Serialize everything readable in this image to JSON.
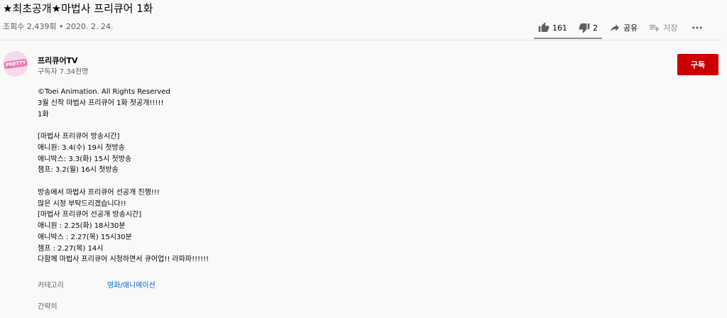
{
  "video": {
    "title": "★최초공개★마법사 프리큐어 1화",
    "views": "조회수 2,439회",
    "separator": "•",
    "date": "2020. 2. 24."
  },
  "actions": {
    "like_count": "161",
    "dislike_count": "2",
    "share_label": "공유",
    "save_label": "저장",
    "like_ratio": 0.988
  },
  "channel": {
    "name": "프리큐어TV",
    "subscribers": "구독자 7.34천명",
    "avatar_text": "PRETTY",
    "subscribe_label": "구독"
  },
  "description": {
    "lines": [
      "©Toei Animation. All Rights Reserved",
      "3월 신작 마법사 프리큐어 1화 첫공개!!!!!",
      "1화",
      "",
      "[마법사 프리큐어 방송시간]",
      "애니원: 3.4(수) 19시 첫방송",
      "애니박스: 3.3(화) 15시 첫방송",
      "챔프: 3.2(월) 16시 첫방송",
      "",
      "방송에서 마법사 프리큐어 선공개 진행!!!",
      "많은 시청 부탁드리겠습니다!!",
      "[마법사 프리큐어 선공개 방송시간]",
      "애니원 : 2.25(화) 18시30분",
      "애니박스 : 2.27(목) 15시30분",
      "챔프 : 2.27(목) 14시",
      "다함께 마법사 프리큐어 시청하면서 큐어업!! 라파파!!!!!!"
    ]
  },
  "category": {
    "label": "카테고리",
    "value": "영화/애니메이션"
  },
  "show_less": "간략히",
  "colors": {
    "subscribe": "#cc0000",
    "link": "#065fd4",
    "secondary_text": "#606060"
  }
}
